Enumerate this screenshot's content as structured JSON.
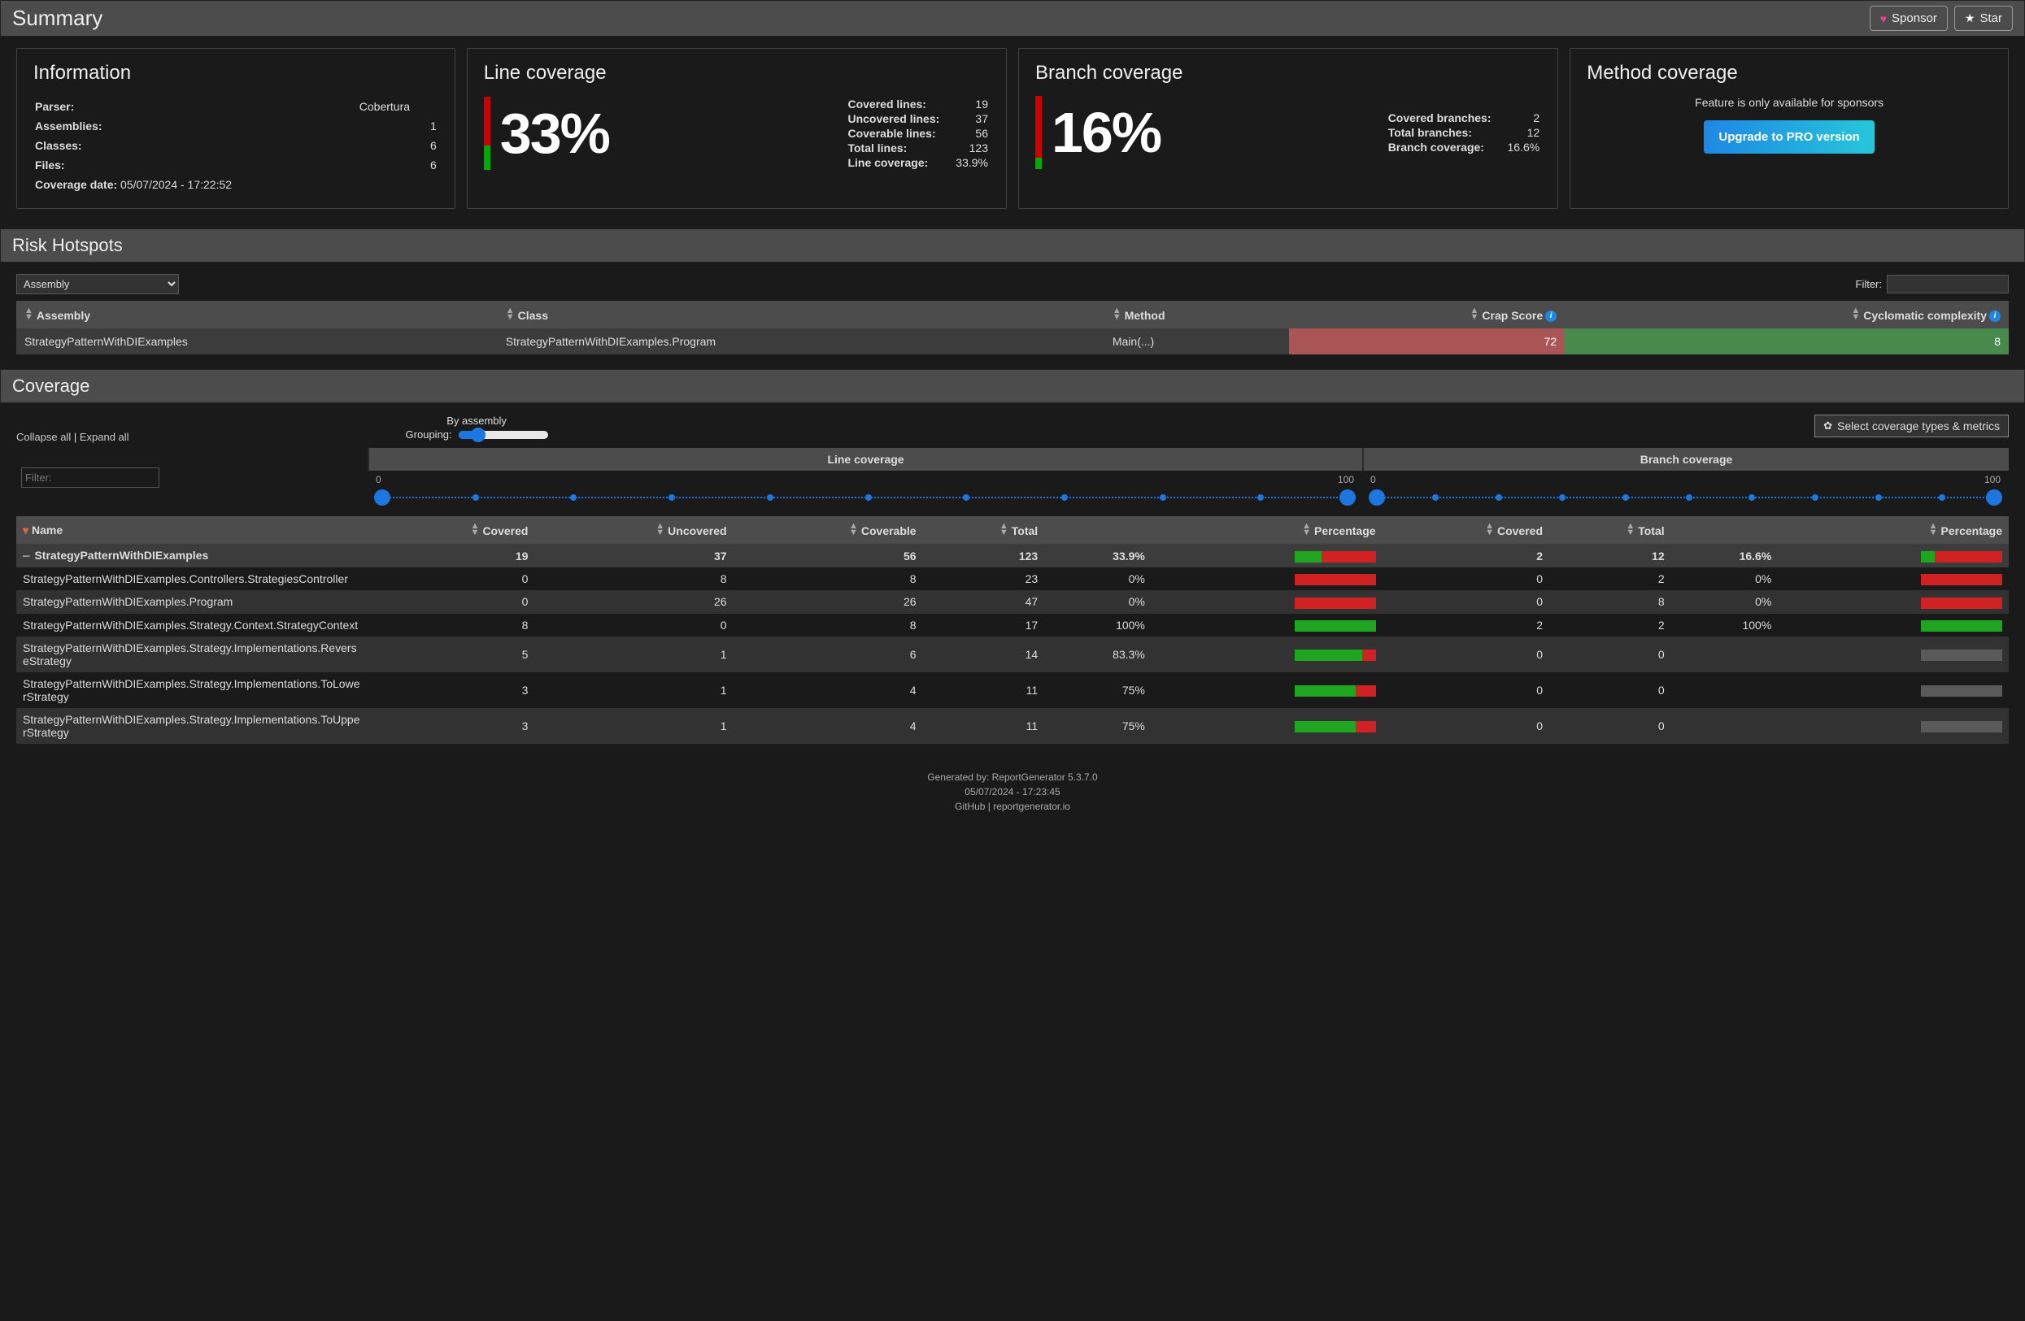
{
  "header": {
    "title": "Summary",
    "sponsor": "Sponsor",
    "star": "Star"
  },
  "info_card": {
    "title": "Information",
    "rows": {
      "parser_k": "Parser:",
      "parser_v": "Cobertura",
      "assemblies_k": "Assemblies:",
      "assemblies_v": "1",
      "classes_k": "Classes:",
      "classes_v": "6",
      "files_k": "Files:",
      "files_v": "6",
      "date_k": "Coverage date:",
      "date_v": "05/07/2024 - 17:22:52"
    }
  },
  "line_card": {
    "title": "Line coverage",
    "pct": "33%",
    "rows": {
      "covered_k": "Covered lines:",
      "covered_v": "19",
      "uncov_k": "Uncovered lines:",
      "uncov_v": "37",
      "covable_k": "Coverable lines:",
      "covable_v": "56",
      "total_k": "Total lines:",
      "total_v": "123",
      "cov_k": "Line coverage:",
      "cov_v": "33.9%"
    }
  },
  "branch_card": {
    "title": "Branch coverage",
    "pct": "16%",
    "rows": {
      "covered_k": "Covered branches:",
      "covered_v": "2",
      "total_k": "Total branches:",
      "total_v": "12",
      "cov_k": "Branch coverage:",
      "cov_v": "16.6%"
    }
  },
  "method_card": {
    "title": "Method coverage",
    "text": "Feature is only available for sponsors",
    "button": "Upgrade to PRO version"
  },
  "risk": {
    "title": "Risk Hotspots",
    "assy_option": "Assembly",
    "filter_label": "Filter:",
    "cols": {
      "assembly": "Assembly",
      "class": "Class",
      "method": "Method",
      "crap": "Crap Score",
      "cc": "Cyclomatic complexity"
    },
    "rows": [
      {
        "assembly": "StrategyPatternWithDIExamples",
        "class": "StrategyPatternWithDIExamples.Program",
        "method": "Main(...)",
        "crap": "72",
        "cc": "8"
      }
    ]
  },
  "coverage": {
    "title": "Coverage",
    "collapse": "Collapse all",
    "expand": "Expand all",
    "grouping_label": "Grouping:",
    "grouping_value": "By assembly",
    "select_metrics": "Select coverage types & metrics",
    "line_title": "Line coverage",
    "branch_title": "Branch coverage",
    "range_min": "0",
    "range_max": "100",
    "filter_placeholder": "Filter:",
    "cols": {
      "name": "Name",
      "covered": "Covered",
      "uncovered": "Uncovered",
      "coverable": "Coverable",
      "total": "Total",
      "percentage": "Percentage",
      "b_covered": "Covered",
      "b_total": "Total",
      "b_percentage": "Percentage"
    },
    "total": {
      "name": "StrategyPatternWithDIExamples",
      "covered": "19",
      "uncovered": "37",
      "coverable": "56",
      "total": "123",
      "pct": "33.9%",
      "b_cov": "2",
      "b_tot": "12",
      "b_pct": "16.6%"
    },
    "rows": [
      {
        "name": "StrategyPatternWithDIExamples.Controllers.StrategiesController",
        "covered": "0",
        "uncovered": "8",
        "coverable": "8",
        "total": "23",
        "pct": "0%",
        "pg": 0,
        "b_cov": "0",
        "b_tot": "2",
        "b_pct": "0%",
        "pbg": 0
      },
      {
        "name": "StrategyPatternWithDIExamples.Program",
        "covered": "0",
        "uncovered": "26",
        "coverable": "26",
        "total": "47",
        "pct": "0%",
        "pg": 0,
        "b_cov": "0",
        "b_tot": "8",
        "b_pct": "0%",
        "pbg": 0
      },
      {
        "name": "StrategyPatternWithDIExamples.Strategy.Context.StrategyContext",
        "covered": "8",
        "uncovered": "0",
        "coverable": "8",
        "total": "17",
        "pct": "100%",
        "pg": 100,
        "b_cov": "2",
        "b_tot": "2",
        "b_pct": "100%",
        "pbg": 100
      },
      {
        "name": "StrategyPatternWithDIExamples.Strategy.Implementations.ReverseStrategy",
        "covered": "5",
        "uncovered": "1",
        "coverable": "6",
        "total": "14",
        "pct": "83.3%",
        "pg": 83.3,
        "b_cov": "0",
        "b_tot": "0",
        "b_pct": ""
      },
      {
        "name": "StrategyPatternWithDIExamples.Strategy.Implementations.ToLowerStrategy",
        "covered": "3",
        "uncovered": "1",
        "coverable": "4",
        "total": "11",
        "pct": "75%",
        "pg": 75,
        "b_cov": "0",
        "b_tot": "0",
        "b_pct": ""
      },
      {
        "name": "StrategyPatternWithDIExamples.Strategy.Implementations.ToUpperStrategy",
        "covered": "3",
        "uncovered": "1",
        "coverable": "4",
        "total": "11",
        "pct": "75%",
        "pg": 75,
        "b_cov": "0",
        "b_tot": "0",
        "b_pct": ""
      }
    ]
  },
  "footer": {
    "gen": "Generated by: ReportGenerator 5.3.7.0",
    "date": "05/07/2024 - 17:23:45",
    "links": "GitHub | reportgenerator.io"
  },
  "chart_data": [
    {
      "type": "bar",
      "title": "Line coverage",
      "series": [
        {
          "name": "Covered lines",
          "value": 19
        },
        {
          "name": "Uncovered lines",
          "value": 37
        },
        {
          "name": "Coverable lines",
          "value": 56
        },
        {
          "name": "Total lines",
          "value": 123
        }
      ],
      "percentage": 33.9
    },
    {
      "type": "bar",
      "title": "Branch coverage",
      "series": [
        {
          "name": "Covered branches",
          "value": 2
        },
        {
          "name": "Total branches",
          "value": 12
        }
      ],
      "percentage": 16.6
    },
    {
      "type": "table",
      "title": "Coverage by class",
      "columns": [
        "Name",
        "Covered",
        "Uncovered",
        "Coverable",
        "Total",
        "Line %",
        "Branch Covered",
        "Branch Total",
        "Branch %"
      ],
      "rows": [
        [
          "StrategyPatternWithDIExamples",
          19,
          37,
          56,
          123,
          33.9,
          2,
          12,
          16.6
        ],
        [
          "...Controllers.StrategiesController",
          0,
          8,
          8,
          23,
          0,
          0,
          2,
          0
        ],
        [
          "...Program",
          0,
          26,
          26,
          47,
          0,
          0,
          8,
          0
        ],
        [
          "...Strategy.Context.StrategyContext",
          8,
          0,
          8,
          17,
          100,
          2,
          2,
          100
        ],
        [
          "...Strategy.Implementations.ReverseStrategy",
          5,
          1,
          6,
          14,
          83.3,
          0,
          0,
          null
        ],
        [
          "...Strategy.Implementations.ToLowerStrategy",
          3,
          1,
          4,
          11,
          75,
          0,
          0,
          null
        ],
        [
          "...Strategy.Implementations.ToUpperStrategy",
          3,
          1,
          4,
          11,
          75,
          0,
          0,
          null
        ]
      ]
    }
  ]
}
